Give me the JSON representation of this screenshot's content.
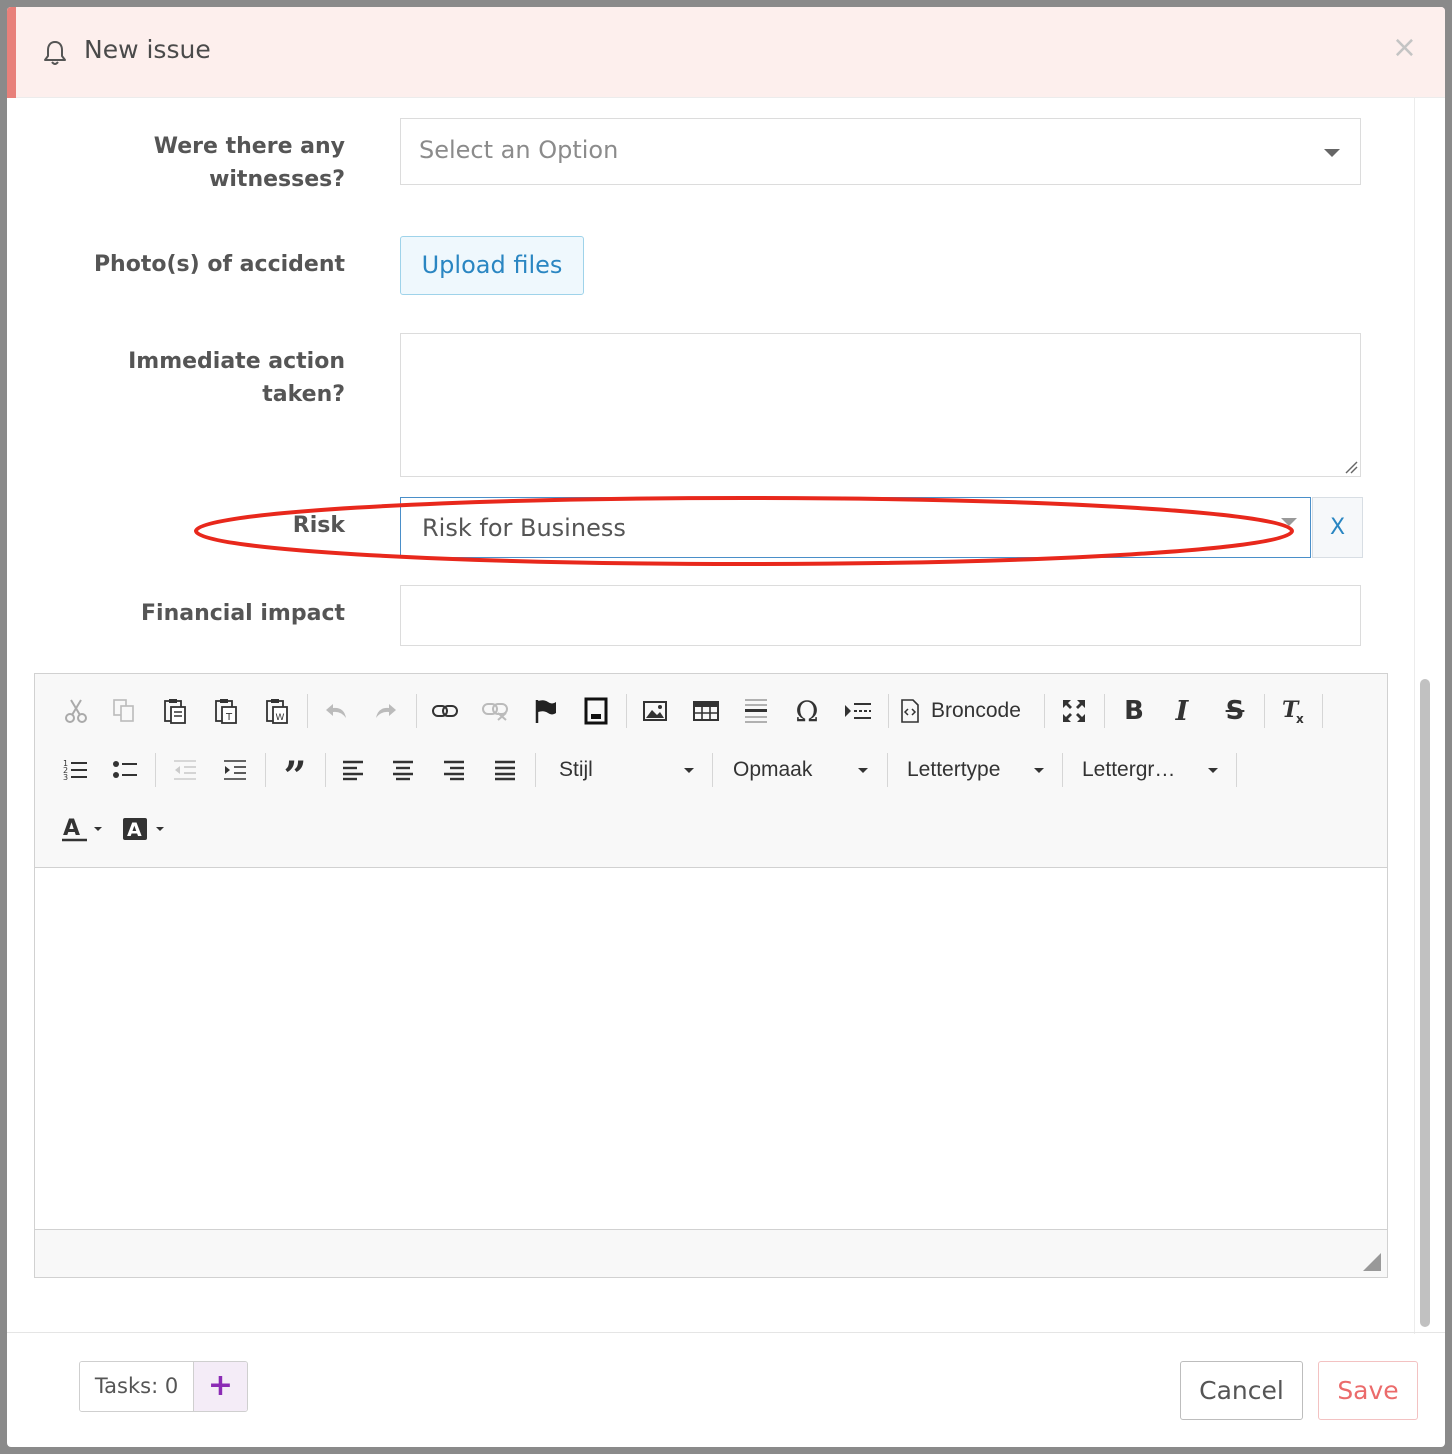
{
  "modal": {
    "title": "New issue",
    "close_label": "×"
  },
  "form": {
    "witnesses": {
      "label": "Were there any witnesses?",
      "placeholder": "Select an Option"
    },
    "photos": {
      "label": "Photo(s) of accident",
      "button": "Upload files"
    },
    "immediate_action": {
      "label": "Immediate action taken?",
      "value": ""
    },
    "risk": {
      "label": "Risk",
      "value": "Risk for Business",
      "clear_label": "X"
    },
    "financial_impact": {
      "label": "Financial impact",
      "value": ""
    }
  },
  "editor": {
    "toolbar": {
      "source_label": "Broncode",
      "style_combo": "Stijl",
      "format_combo": "Opmaak",
      "font_combo": "Lettertype",
      "size_combo": "Lettergr…"
    }
  },
  "footer": {
    "tasks_label": "Tasks: 0",
    "tasks_add": "+",
    "cancel": "Cancel",
    "save": "Save"
  },
  "colors": {
    "header_bg": "#fdefed",
    "accent": "#e8807a",
    "link_blue": "#2a86c2",
    "annotation_red": "#e8281c",
    "save_red": "#eb6b6b",
    "tasks_purple": "#8b2bb5"
  }
}
